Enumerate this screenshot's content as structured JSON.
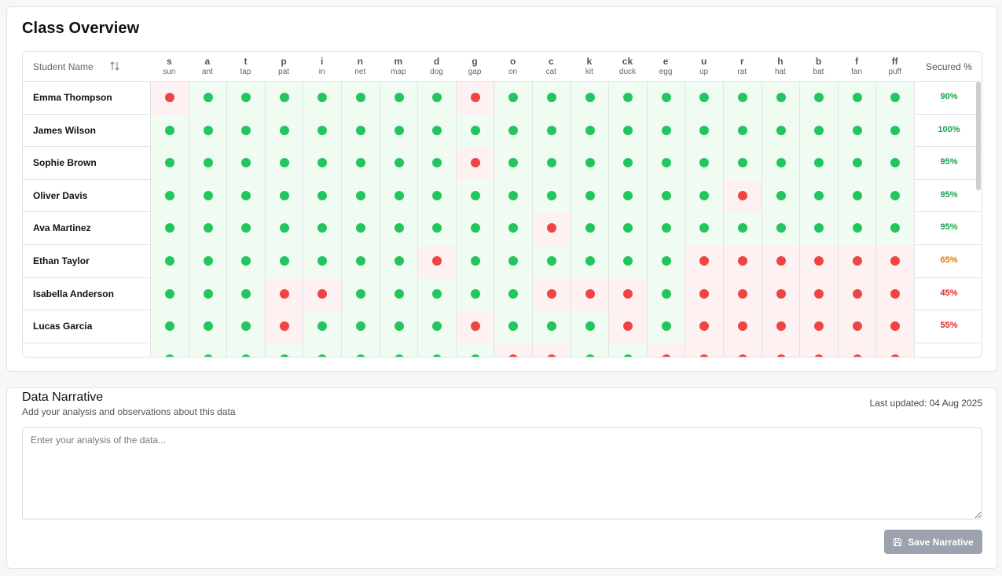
{
  "overview": {
    "title": "Class Overview",
    "name_header": "Student Name",
    "secured_header": "Secured %",
    "columns": [
      {
        "letter": "s",
        "word": "sun"
      },
      {
        "letter": "a",
        "word": "ant"
      },
      {
        "letter": "t",
        "word": "tap"
      },
      {
        "letter": "p",
        "word": "pat"
      },
      {
        "letter": "i",
        "word": "in"
      },
      {
        "letter": "n",
        "word": "net"
      },
      {
        "letter": "m",
        "word": "map"
      },
      {
        "letter": "d",
        "word": "dog"
      },
      {
        "letter": "g",
        "word": "gap"
      },
      {
        "letter": "o",
        "word": "on"
      },
      {
        "letter": "c",
        "word": "cat"
      },
      {
        "letter": "k",
        "word": "kit"
      },
      {
        "letter": "ck",
        "word": "duck"
      },
      {
        "letter": "e",
        "word": "egg"
      },
      {
        "letter": "u",
        "word": "up"
      },
      {
        "letter": "r",
        "word": "rat"
      },
      {
        "letter": "h",
        "word": "hat"
      },
      {
        "letter": "b",
        "word": "bat"
      },
      {
        "letter": "f",
        "word": "fan"
      },
      {
        "letter": "ff",
        "word": "puff"
      }
    ],
    "students": [
      {
        "name": "Emma Thompson",
        "secured": "90%",
        "status": [
          0,
          1,
          1,
          1,
          1,
          1,
          1,
          1,
          0,
          1,
          1,
          1,
          1,
          1,
          1,
          1,
          1,
          1,
          1,
          1
        ]
      },
      {
        "name": "James Wilson",
        "secured": "100%",
        "status": [
          1,
          1,
          1,
          1,
          1,
          1,
          1,
          1,
          1,
          1,
          1,
          1,
          1,
          1,
          1,
          1,
          1,
          1,
          1,
          1
        ]
      },
      {
        "name": "Sophie Brown",
        "secured": "95%",
        "status": [
          1,
          1,
          1,
          1,
          1,
          1,
          1,
          1,
          0,
          1,
          1,
          1,
          1,
          1,
          1,
          1,
          1,
          1,
          1,
          1
        ]
      },
      {
        "name": "Oliver Davis",
        "secured": "95%",
        "status": [
          1,
          1,
          1,
          1,
          1,
          1,
          1,
          1,
          1,
          1,
          1,
          1,
          1,
          1,
          1,
          0,
          1,
          1,
          1,
          1
        ]
      },
      {
        "name": "Ava Martinez",
        "secured": "95%",
        "status": [
          1,
          1,
          1,
          1,
          1,
          1,
          1,
          1,
          1,
          1,
          0,
          1,
          1,
          1,
          1,
          1,
          1,
          1,
          1,
          1
        ]
      },
      {
        "name": "Ethan Taylor",
        "secured": "65%",
        "status": [
          1,
          1,
          1,
          1,
          1,
          1,
          1,
          0,
          1,
          1,
          1,
          1,
          1,
          1,
          0,
          0,
          0,
          0,
          0,
          0
        ]
      },
      {
        "name": "Isabella Anderson",
        "secured": "45%",
        "status": [
          1,
          1,
          1,
          0,
          0,
          1,
          1,
          1,
          1,
          1,
          0,
          0,
          0,
          1,
          0,
          0,
          0,
          0,
          0,
          0
        ]
      },
      {
        "name": "Lucas Garcia",
        "secured": "55%",
        "status": [
          1,
          1,
          1,
          0,
          1,
          1,
          1,
          1,
          0,
          1,
          1,
          1,
          0,
          1,
          0,
          0,
          0,
          0,
          0,
          0
        ]
      },
      {
        "name": "",
        "secured": "",
        "status": [
          1,
          1,
          1,
          1,
          1,
          1,
          1,
          1,
          1,
          0,
          0,
          1,
          1,
          0,
          0,
          0,
          0,
          0,
          0,
          0
        ]
      }
    ],
    "colors": {
      "secured": "#22c55e",
      "not_secured": "#ef4444",
      "pct_high": "#16a34a",
      "pct_mid": "#d97706",
      "pct_low": "#dc2626"
    }
  },
  "narrative": {
    "title": "Data Narrative",
    "subtitle": "Add your analysis and observations about this data",
    "last_updated": "Last updated: 04 Aug 2025",
    "placeholder": "Enter your analysis of the data...",
    "save_label": "Save Narrative",
    "save_icon": "save-icon"
  }
}
